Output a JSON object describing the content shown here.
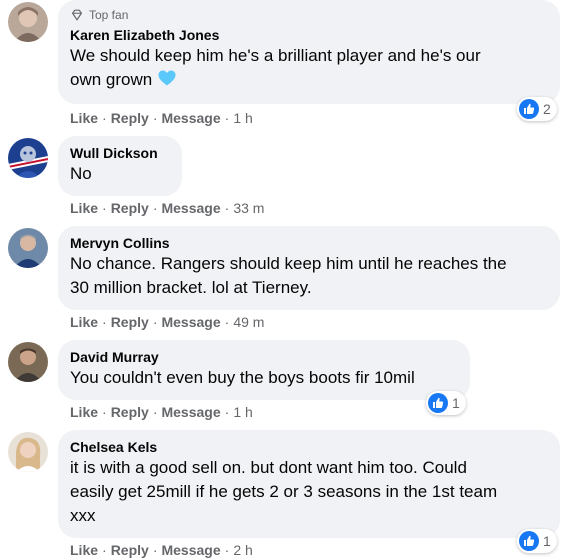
{
  "colors": {
    "bubble_bg": "#f0f2f5",
    "like_blue": "#1877f2",
    "heart_blue": "#5ac8fa",
    "meta_gray": "#65676b"
  },
  "actions": {
    "like": "Like",
    "reply": "Reply",
    "message": "Message",
    "separator": "·"
  },
  "comments": [
    {
      "badge": {
        "icon": "diamond-icon",
        "label": "Top fan"
      },
      "author": "Karen Elizabeth Jones",
      "text_line1": "We should keep him he's a brilliant player and he's our",
      "text_line2": "own grown",
      "emoji": "blue-heart-icon",
      "time": "1 h",
      "reactions": {
        "icon": "like-icon",
        "count": "2"
      }
    },
    {
      "author": "Wull Dickson",
      "text": "No",
      "time": "33 m"
    },
    {
      "author": "Mervyn Collins",
      "text_line1": "No chance. Rangers should keep him until he reaches the",
      "text_line2": "30 million bracket. lol at Tierney.",
      "time": "49 m"
    },
    {
      "author": "David Murray",
      "text": "You couldn't even buy the boys boots fir 10mil",
      "time": "1 h",
      "reactions": {
        "icon": "like-icon",
        "count": "1"
      }
    },
    {
      "author": "Chelsea Kels",
      "text_line1": "it is with a good sell on. but dont want him too. Could",
      "text_line2": "easily get 25mill if he gets 2 or 3 seasons in the 1st team",
      "text_line3": "xxx",
      "time": "2 h",
      "reactions": {
        "icon": "like-icon",
        "count": "1"
      }
    }
  ]
}
